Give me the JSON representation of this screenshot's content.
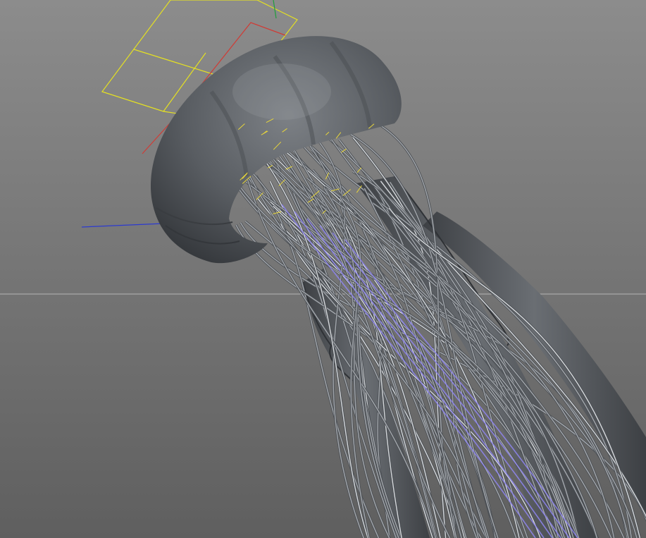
{
  "viewport": {
    "view_type": "perspective-3d",
    "shading": "gouraud",
    "object": "jellyfish",
    "object_color": "#54585d",
    "background_top": "#8c8c8c",
    "background_bottom": "#5f5f5f",
    "horizon_color": "#b4b4b4",
    "tentacle_color": "#a3a7ac",
    "tentacle_highlight": "#d6d9dc",
    "selection_highlight": "#8f86f2",
    "gizmo_colors": {
      "x_axis": "#d03b35",
      "y_axis": "#1fa03a",
      "z_axis": "#2c3ad0",
      "camera_frame": "#e4e022",
      "hair_guides": "#e8d63a"
    }
  }
}
